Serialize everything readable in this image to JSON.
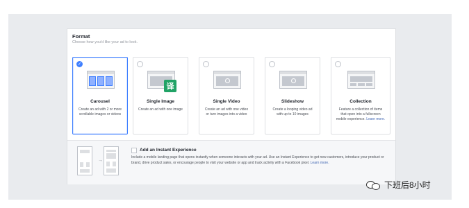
{
  "format": {
    "title": "Format",
    "subtitle": "Choose how you'd like your ad to look."
  },
  "cards": [
    {
      "id": "carousel",
      "title": "Carousel",
      "description": "Create an ad with 2 or more scrollable images or videos",
      "selected": true,
      "icon": "carousel-thumbnail"
    },
    {
      "id": "single-image",
      "title": "Single Image",
      "description": "Create an ad with one image",
      "selected": false,
      "icon": "image-thumbnail"
    },
    {
      "id": "single-video",
      "title": "Single Video",
      "description": "Create an ad with one video or turn images into a video",
      "selected": false,
      "icon": "video-thumbnail"
    },
    {
      "id": "slideshow",
      "title": "Slideshow",
      "description": "Create a looping video ad with up to 10 images",
      "selected": false,
      "icon": "slideshow-thumbnail"
    },
    {
      "id": "collection",
      "title": "Collection",
      "description": "Feature a collection of items that open into a fullscreen mobile experience.",
      "link": "Learn more.",
      "selected": false,
      "icon": "collection-thumbnail"
    }
  ],
  "translate_badge": "译",
  "instant_experience": {
    "title": "Add an Instant Experience",
    "description": "Include a mobile landing page that opens instantly when someone interacts with your ad. Use an Instant Experience to get new customers, introduce your product or brand, drive product sales, or encourage people to visit your website or app and track activity with a Facebook pixel.",
    "link": "Learn more."
  },
  "watermark": {
    "text": "下班后8小时"
  },
  "colors": {
    "accent": "#4080ff",
    "link": "#4267b2",
    "background": "#e9ebee"
  }
}
